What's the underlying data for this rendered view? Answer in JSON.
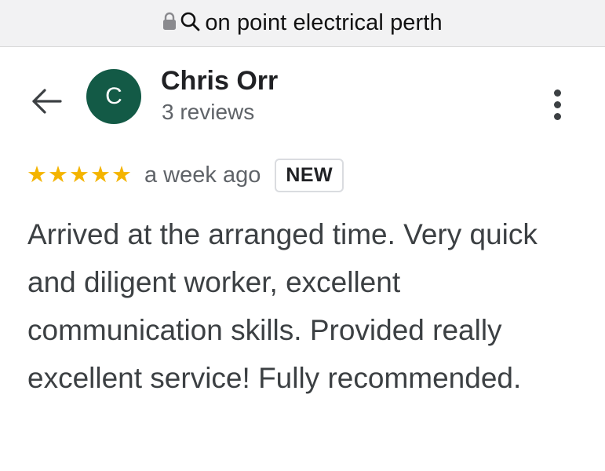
{
  "browser": {
    "url_text": "on point electrical perth",
    "icons": [
      "lock-icon",
      "search-icon"
    ]
  },
  "review": {
    "reviewer_name": "Chris Orr",
    "reviewer_initial": "C",
    "reviewer_reviews": "3 reviews",
    "rating": 5,
    "rating_max": 5,
    "time_ago": "a week ago",
    "badge": "NEW",
    "text": "Arrived at the arranged time. Very quick and diligent worker, excellent communication skills. Provided really excellent service! Fully recommended."
  },
  "icons": {
    "back": "arrow-left-icon",
    "more": "more-vertical-icon",
    "star": "star-icon"
  },
  "colors": {
    "avatar_bg": "#135a46",
    "star": "#f4b400",
    "url_bar_bg": "#f2f2f3"
  }
}
